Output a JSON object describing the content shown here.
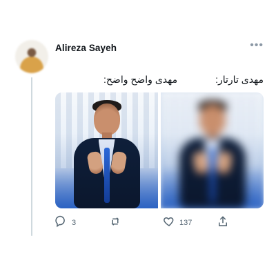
{
  "tweet": {
    "author_name": "Alireza Sayeh",
    "captions": {
      "left": "مهدی واضح واضح:",
      "right": "مهدی تارتار:"
    },
    "actions": {
      "reply_count": "3",
      "retweet_count": "",
      "like_count": "137"
    }
  },
  "icons": {
    "reply": "reply-icon",
    "retweet": "retweet-icon",
    "like": "heart-icon",
    "share": "share-icon",
    "more": "more-icon"
  },
  "colors": {
    "text": "#0f1419",
    "secondary": "#536471",
    "thread_line": "#cfd9de"
  }
}
